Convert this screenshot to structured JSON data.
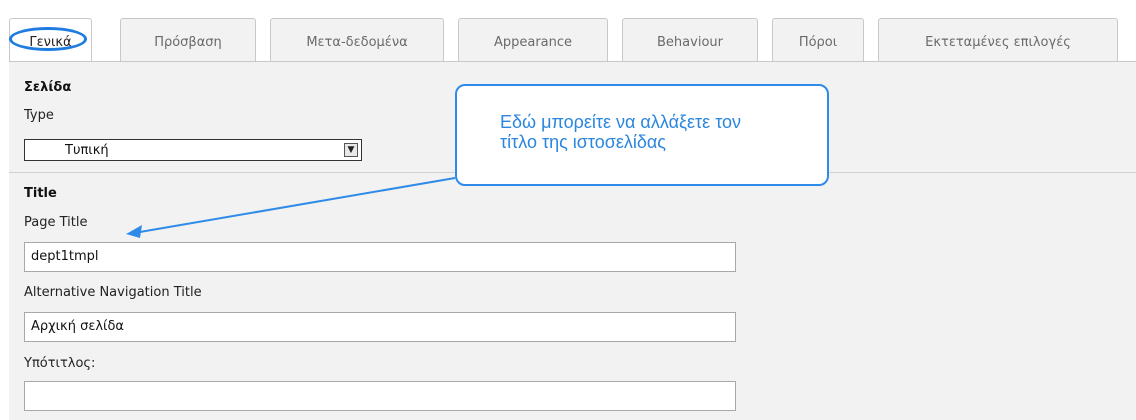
{
  "tabs": [
    {
      "label": "Γενικά"
    },
    {
      "label": "Πρόσβαση"
    },
    {
      "label": "Μετα-δεδομένα"
    },
    {
      "label": "Appearance"
    },
    {
      "label": "Behaviour"
    },
    {
      "label": "Πόροι"
    },
    {
      "label": "Εκτεταμένες επιλογές"
    }
  ],
  "page_section": {
    "header": "Σελίδα",
    "type_label": "Type",
    "type_value": "Τυπική"
  },
  "title_section": {
    "header": "Title",
    "page_title_label": "Page Title",
    "page_title_value": "dept1tmpl",
    "nav_title_label": "Alternative Navigation Title",
    "nav_title_value": "Αρχική σελίδα",
    "subtitle_label": "Υπότιτλος:",
    "subtitle_value": ""
  },
  "callout": {
    "line1": "Εδώ μπορείτε να αλλάξετε τον",
    "line2": "τίτλο της ιστοσελίδας"
  },
  "colors": {
    "annotation": "#2f8be8",
    "panel_bg": "#f2f2f2"
  },
  "icons": {
    "dropdown": "chevron-down-icon",
    "pointer": "arrow-icon"
  }
}
